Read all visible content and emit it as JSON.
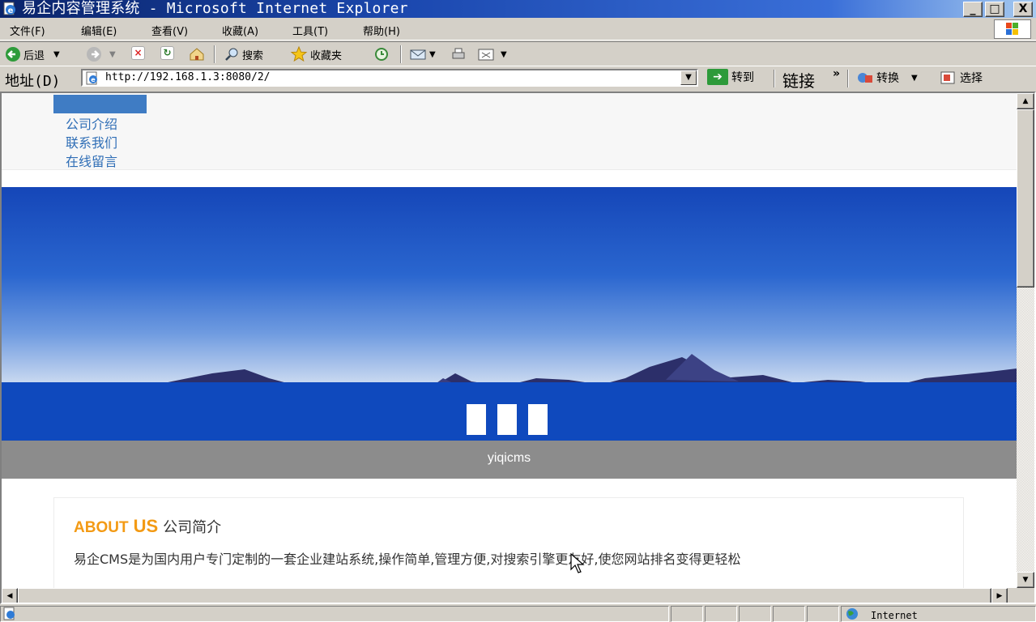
{
  "window": {
    "title": "易企内容管理系统 - Microsoft Internet Explorer",
    "controls": {
      "minimize": "_",
      "maximize": "□",
      "close": "X"
    }
  },
  "menubar": {
    "items": [
      {
        "label": "文件(F)"
      },
      {
        "label": "编辑(E)"
      },
      {
        "label": "查看(V)"
      },
      {
        "label": "收藏(A)"
      },
      {
        "label": "工具(T)"
      },
      {
        "label": "帮助(H)"
      }
    ]
  },
  "toolbar": {
    "back": "后退",
    "search": "搜索",
    "favorites": "收藏夹"
  },
  "addressbar": {
    "label": "地址(D)",
    "url": "http://192.168.1.3:8080/2/",
    "go": "转到",
    "links": "链接",
    "links_more": "»",
    "convert": "转换",
    "select": "选择"
  },
  "page": {
    "nav": [
      "公司介绍",
      "联系我们",
      "在线留言"
    ],
    "banner_caption": "yiqicms",
    "about": {
      "title_en_1": "ABOUT",
      "title_en_2": "US",
      "title_cn": "公司简介",
      "text": "易企CMS是为国内用户专门定制的一套企业建站系统,操作简单,管理方便,对搜索引擎更友好,使您网站排名变得更轻松"
    }
  },
  "statusbar": {
    "zone": "Internet"
  },
  "colors": {
    "title_bar": "#0a246a",
    "nav_link": "#2f6eb6",
    "nav_highlight": "#3f7cc4",
    "about_accent": "#f39a14",
    "caption_bar": "#8c8c8c"
  }
}
